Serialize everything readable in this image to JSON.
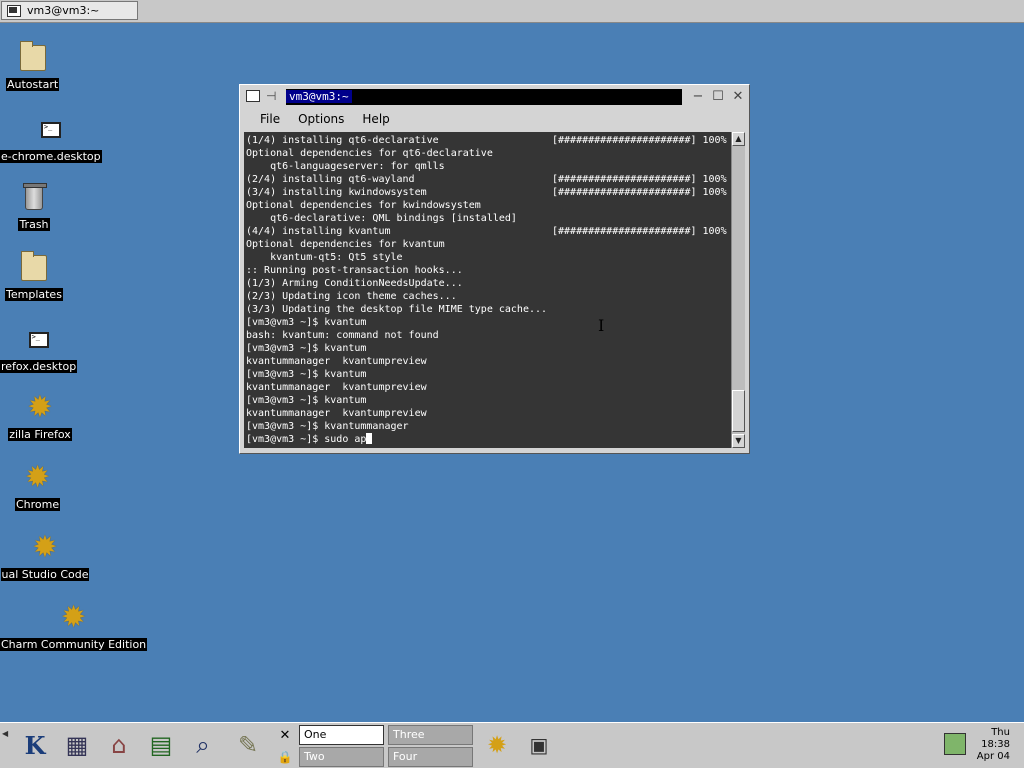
{
  "top_taskbar": {
    "task_title": "vm3@vm3:~"
  },
  "desktop_icons": [
    {
      "label": "Autostart",
      "icon": "folder-icon"
    },
    {
      "label": "e-chrome.desktop",
      "icon": "terminal-file-icon"
    },
    {
      "label": "Trash",
      "icon": "trash-icon"
    },
    {
      "label": "Templates",
      "icon": "folder-icon"
    },
    {
      "label": "refox.desktop",
      "icon": "terminal-file-icon"
    },
    {
      "label": "zilla Firefox",
      "icon": "gear-icon"
    },
    {
      "label": "Chrome",
      "icon": "gear-icon"
    },
    {
      "label": "ual Studio Code",
      "icon": "gear-icon"
    },
    {
      "label": "Charm Community Edition",
      "icon": "gear-icon"
    }
  ],
  "terminal": {
    "title": "vm3@vm3:~",
    "menu": [
      "File",
      "Options",
      "Help"
    ],
    "lines": [
      {
        "text": "(1/4) installing qt6-declarative",
        "progress": "[######################] 100%"
      },
      {
        "text": "Optional dependencies for qt6-declarative",
        "progress": ""
      },
      {
        "text": "    qt6-languageserver: for qmlls",
        "progress": ""
      },
      {
        "text": "(2/4) installing qt6-wayland",
        "progress": "[######################] 100%"
      },
      {
        "text": "(3/4) installing kwindowsystem",
        "progress": "[######################] 100%"
      },
      {
        "text": "Optional dependencies for kwindowsystem",
        "progress": ""
      },
      {
        "text": "    qt6-declarative: QML bindings [installed]",
        "progress": ""
      },
      {
        "text": "(4/4) installing kvantum",
        "progress": "[######################] 100%"
      },
      {
        "text": "Optional dependencies for kvantum",
        "progress": ""
      },
      {
        "text": "    kvantum-qt5: Qt5 style",
        "progress": ""
      },
      {
        "text": ":: Running post-transaction hooks...",
        "progress": ""
      },
      {
        "text": "(1/3) Arming ConditionNeedsUpdate...",
        "progress": ""
      },
      {
        "text": "(2/3) Updating icon theme caches...",
        "progress": ""
      },
      {
        "text": "(3/3) Updating the desktop file MIME type cache...",
        "progress": ""
      },
      {
        "text": "[vm3@vm3 ~]$ kvantum",
        "progress": ""
      },
      {
        "text": "bash: kvantum: command not found",
        "progress": ""
      },
      {
        "text": "[vm3@vm3 ~]$ kvantum",
        "progress": ""
      },
      {
        "text": "kvantummanager  kvantumpreview",
        "progress": ""
      },
      {
        "text": "[vm3@vm3 ~]$ kvantum",
        "progress": ""
      },
      {
        "text": "kvantummanager  kvantumpreview",
        "progress": ""
      },
      {
        "text": "[vm3@vm3 ~]$ kvantum",
        "progress": ""
      },
      {
        "text": "kvantummanager  kvantumpreview",
        "progress": ""
      },
      {
        "text": "[vm3@vm3 ~]$ kvantummanager",
        "progress": ""
      }
    ],
    "current_input": "[vm3@vm3 ~]$ sudo ap"
  },
  "panel": {
    "pager": {
      "desktops": [
        "One",
        "Three",
        "Two",
        "Four"
      ],
      "active": "One"
    },
    "clock": {
      "day": "Thu",
      "time": "18:38",
      "date": "Apr 04"
    }
  },
  "colors": {
    "desktop_bg": "#4a7fb5",
    "terminal_bg": "#353535",
    "panel_bg": "#c8c8c8"
  }
}
